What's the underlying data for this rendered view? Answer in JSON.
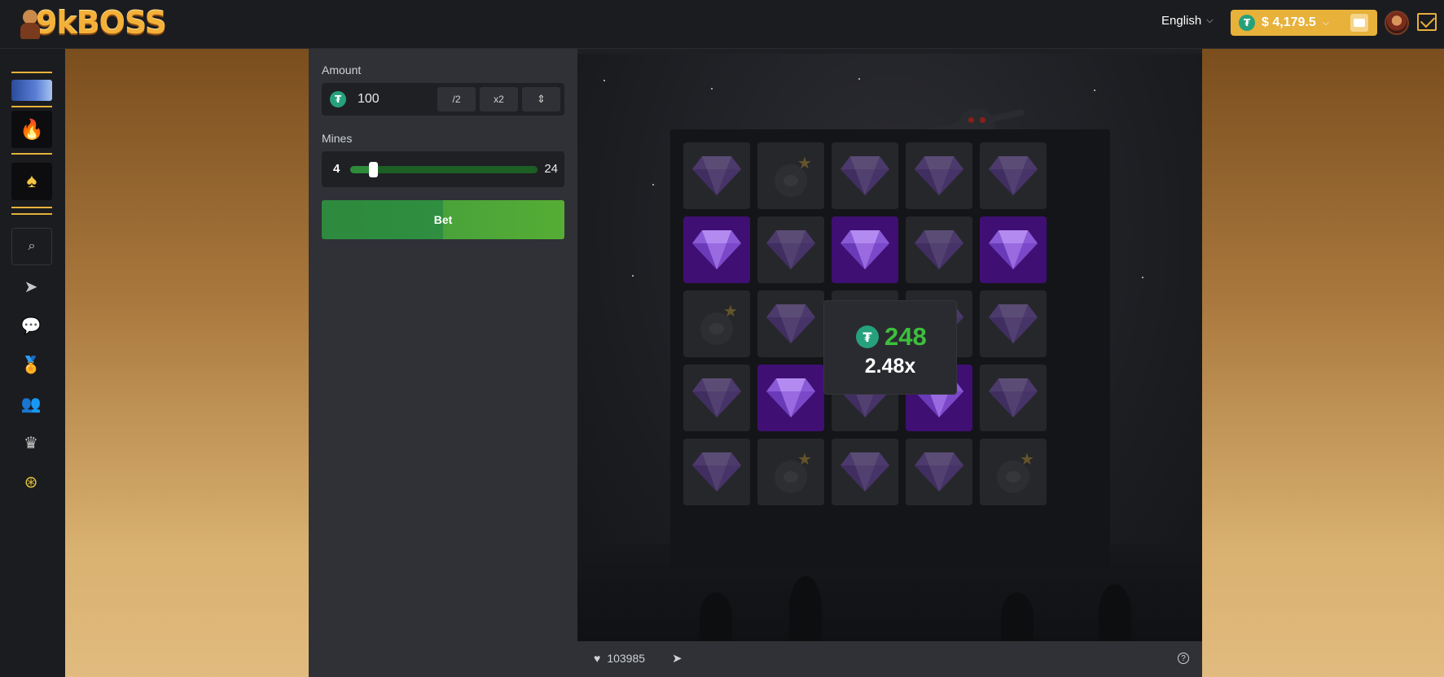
{
  "header": {
    "logo_text": "9kBOSS",
    "language": "English",
    "balance": "$ 4,179.5",
    "currency_symbol": "₮"
  },
  "sidebar": {
    "items": [
      {
        "name": "promo-banner"
      },
      {
        "name": "hot-games",
        "icon": "fire-icon"
      },
      {
        "name": "casino",
        "icon": "spade-icon"
      },
      {
        "name": "search",
        "icon": "search-icon"
      },
      {
        "name": "telegram",
        "icon": "paper-plane-icon"
      },
      {
        "name": "chat",
        "icon": "chat-icon"
      },
      {
        "name": "rewards",
        "icon": "medal-icon"
      },
      {
        "name": "referral",
        "icon": "users-icon"
      },
      {
        "name": "vip",
        "icon": "crown-icon"
      },
      {
        "name": "bonus",
        "icon": "coin-icon"
      }
    ]
  },
  "bet_panel": {
    "amount_label": "Amount",
    "amount_value": "100",
    "half_label": "/2",
    "double_label": "x2",
    "mines_label": "Mines",
    "mines_min": "4",
    "mines_max": "24",
    "mines_value_fraction": 0.1,
    "bet_label": "Bet"
  },
  "game": {
    "grid": [
      [
        "gem-dim",
        "mine",
        "gem-dim",
        "gem-dim",
        "gem-dim"
      ],
      [
        "gem-lit",
        "gem-dim",
        "gem-lit",
        "gem-dim",
        "gem-lit"
      ],
      [
        "mine",
        "gem-dim",
        "gem-dim",
        "gem-dim",
        "gem-dim"
      ],
      [
        "gem-dim",
        "gem-lit",
        "gem-dim",
        "gem-lit",
        "gem-dim"
      ],
      [
        "gem-dim",
        "mine",
        "gem-dim",
        "gem-dim",
        "mine"
      ]
    ],
    "win_amount": "248",
    "multiplier": "2.48x"
  },
  "footer": {
    "likes": "103985"
  },
  "colors": {
    "accent": "#e7b13a",
    "win_green": "#3cc03c",
    "gem_lit_bg": "#3f0f73",
    "bet_green": "#2d8a3e"
  }
}
